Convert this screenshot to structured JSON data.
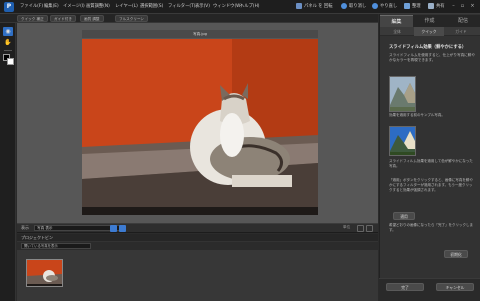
{
  "app": {
    "logo_letter": "P"
  },
  "menu": {
    "items": [
      "ファイル(F)",
      "編集(E)",
      "イメージ(I)",
      "画質調整(N)",
      "レイヤー(L)",
      "選択範囲(S)",
      "フィルター(T)",
      "表示(V)",
      "ウィンドウ(W)",
      "ヘルプ(H)"
    ],
    "right": {
      "fix": "パネル を 回転",
      "undo": "取り消し",
      "redo": "やり直し",
      "organizer": "整理",
      "share": "共有"
    }
  },
  "options_bar": [
    "クイック 補正",
    "ガイド付き",
    "画質 調整",
    "フルスクリーン"
  ],
  "document": {
    "title": "写真.jpg"
  },
  "status": {
    "zoom_label": "表示",
    "zoom_value": "写真 表示",
    "units_label": "単位"
  },
  "project_bin": {
    "title": "プロジェクトビン",
    "filter": "開いている写真を表示"
  },
  "panel": {
    "tabs": [
      "編集",
      "作成",
      "配信"
    ],
    "active_tab": 0,
    "subtabs": [
      "全体",
      "クイック",
      "ガイド"
    ],
    "heading": "スライドフィルム効果（鮮やかにする）",
    "desc1": "スライドフィルムを使用すると、仕上がり写真に鮮やかなカラーを再現できます。",
    "caption_before": "効果を適用する前のサンプル写真。",
    "caption_after": "スライドフィルム効果を適用して色が鮮やかになった写真。",
    "desc3": "「適用」ボタンをクリックすると、画像に写真を鮮やかにするフィルターが適用されます。もう一度クリックすると効果が強調されます。",
    "apply_button": "適用",
    "desc4": "希望どおりの画像になったら「完了」をクリックします。",
    "reset_button": "初期化",
    "done_button": "完了",
    "cancel_button": "キャンセル"
  },
  "colors": {
    "accent": "#1f5fb0",
    "panel_bg": "#323232",
    "workspace_bg": "#575757"
  }
}
